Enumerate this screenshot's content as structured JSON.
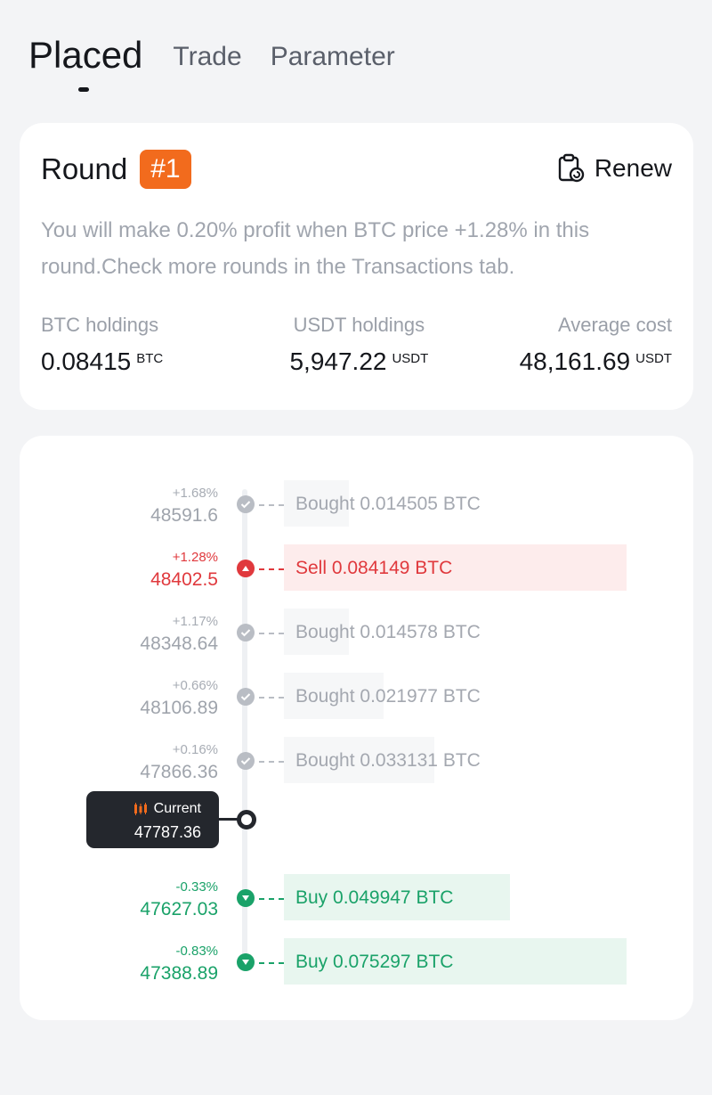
{
  "tabs": [
    {
      "label": "Placed",
      "active": true
    },
    {
      "label": "Trade",
      "active": false
    },
    {
      "label": "Parameter",
      "active": false
    }
  ],
  "round": {
    "label": "Round",
    "badge": "#1",
    "renew_label": "Renew",
    "renew_icon": "clipboard-refresh-icon",
    "description": "You will make 0.20% profit when BTC price +1.28% in this round.Check more rounds in the Transactions tab.",
    "stats": [
      {
        "label": "BTC holdings",
        "value": "0.08415",
        "unit": "BTC"
      },
      {
        "label": "USDT holdings",
        "value": "5,947.22",
        "unit": "USDT"
      },
      {
        "label": "Average cost",
        "value": "48,161.69",
        "unit": "USDT"
      }
    ]
  },
  "ladder": {
    "orders": [
      {
        "pct": "+1.68%",
        "price": "48591.6",
        "text": "Bought 0.014505 BTC",
        "status": "filled",
        "fill": 0.19
      },
      {
        "pct": "+1.28%",
        "price": "48402.5",
        "text": "Sell 0.084149 BTC",
        "status": "sell",
        "fill": 1.0
      },
      {
        "pct": "+1.17%",
        "price": "48348.64",
        "text": "Bought 0.014578 BTC",
        "status": "filled",
        "fill": 0.19
      },
      {
        "pct": "+0.66%",
        "price": "48106.89",
        "text": "Bought 0.021977 BTC",
        "status": "filled",
        "fill": 0.29
      },
      {
        "pct": "+0.16%",
        "price": "47866.36",
        "text": "Bought 0.033131 BTC",
        "status": "filled",
        "fill": 0.44
      },
      {
        "pct": "-0.33%",
        "price": "47627.03",
        "text": "Buy 0.049947 BTC",
        "status": "buy",
        "fill": 0.66
      },
      {
        "pct": "-0.83%",
        "price": "47388.89",
        "text": "Buy 0.075297 BTC",
        "status": "buy",
        "fill": 1.0
      }
    ],
    "current": {
      "label": "Current",
      "price": "47787.36",
      "icon": "candlestick-icon"
    }
  },
  "colors": {
    "accent": "#f26b1d",
    "sell": "#e0393d",
    "buy": "#1aa269",
    "filled": "#b9bdc4"
  }
}
